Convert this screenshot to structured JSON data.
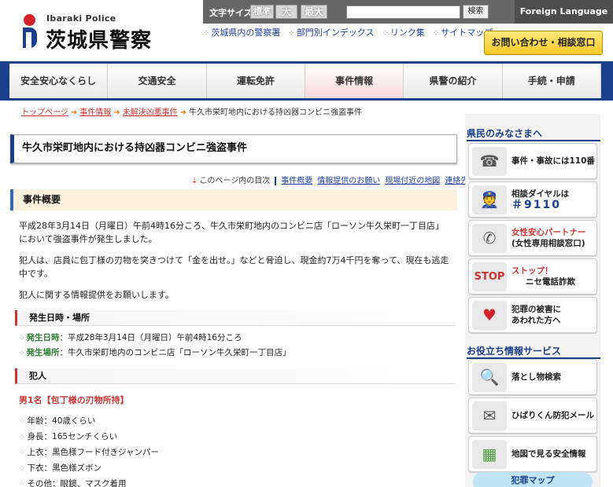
{
  "header": {
    "logo_en": "Ibaraki Police",
    "logo_ja": "茨城県警察",
    "font_size_label": "文字サイズ",
    "font_sizes": [
      "標準",
      "大",
      "最大"
    ],
    "search_button": "検索",
    "foreign_language": "Foreign Language",
    "sublinks": [
      "茨城県内の警察署",
      "部門別インデックス",
      "リンク集",
      "サイトマップ"
    ],
    "contact_button": "お問い合わせ・相談窓口"
  },
  "gnav": [
    "安全安心なくらし",
    "交通安全",
    "運転免許",
    "事件情報",
    "県警の紹介",
    "手続・申請"
  ],
  "breadcrumb": {
    "links": [
      "トップページ",
      "事件情報",
      "未解決凶悪事件"
    ],
    "current": "牛久市栄町地内における持凶器コンビニ強盗事件"
  },
  "main": {
    "title": "牛久市栄町地内における持凶器コンビニ強盗事件",
    "toc_label": "このページ内の目次",
    "toc_links": [
      "事件概要",
      "情報提供のお願い",
      "現場付近の地図",
      "連絡先"
    ],
    "section1": "事件概要",
    "para1": "平成28年3月14日（月曜日）午前4時16分ころ、牛久市栄町地内のコンビニ店「ローソン牛久栄町一丁目店」において強盗事件が発生しました。",
    "para2": "犯人は、店員に包丁様の刃物を突きつけて「金を出せ。」などと脅迫し、現金約7万4千円を奪って、現在も逃走中です。",
    "para3": "犯人に関する情報提供をお願いします。",
    "sub1": "発生日時・場所",
    "date_key": "発生日時",
    "date_val": "：平成28年3月14日（月曜日）午前4時16分ころ",
    "place_key": "発生場所",
    "place_val": "：牛久市栄町地内のコンビニ店「ローソン牛久栄町一丁目店」",
    "sub2": "犯人",
    "suspect_heading": "男1名【包丁様の刃物所持】",
    "suspect_features": [
      "年齢：40歳くらい",
      "身長：165センチくらい",
      "上衣：黒色様フード付きジャンパー",
      "下衣：黒色様ズボン",
      "その他：眼鏡、マスク着用"
    ]
  },
  "sidebar": {
    "heading1": "県民のみなさまへ",
    "items1": [
      {
        "line1": "事件・事故には110番",
        "line2": "",
        "icon": "telephone-icon"
      },
      {
        "line1": "相談ダイヤルは",
        "line2": "＃9110",
        "icon": "police-officer-icon"
      },
      {
        "line1": "女性安心パートナー",
        "line2": "(女性専用相談窓口)",
        "icon": "phone-hand-icon"
      },
      {
        "line1": "ストップ！",
        "line2": "ニセ電話詐欺",
        "icon": "stop-icon"
      },
      {
        "line1": "犯罪の被害に",
        "line2": "あわれた方へ",
        "icon": "heart-mascot-icon"
      }
    ],
    "heading2": "お役立ち情報サービス",
    "items2": [
      {
        "line1": "落とし物検索",
        "line2": "",
        "icon": "lost-item-icon"
      },
      {
        "line1": "ひばりくん防犯メール",
        "line2": "",
        "icon": "mail-mascot-icon"
      },
      {
        "line1": "地図で見る安全情報",
        "line2": "",
        "icon": "map-icon"
      }
    ],
    "crime_map": "犯罪マップ"
  }
}
